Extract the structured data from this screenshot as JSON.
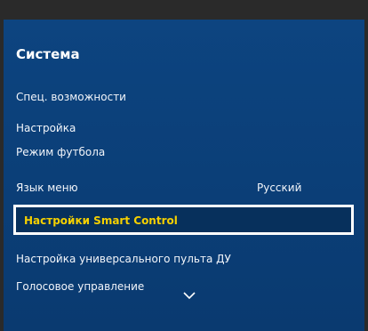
{
  "menu": {
    "title": "Система",
    "items": [
      {
        "label": "Спец. возможности"
      },
      {
        "label": "Настройка"
      },
      {
        "label": "Режим футбола"
      },
      {
        "label": "Язык меню",
        "value": "Русский"
      },
      {
        "label": "Настройки Smart Control"
      },
      {
        "label": "Настройка универсального пульта ДУ"
      },
      {
        "label": "Голосовое управление"
      }
    ],
    "selected_index": 4,
    "scroll_icon": "chevron-down-icon"
  },
  "colors": {
    "panel_bg": "#0b3f78",
    "selected_text": "#f5d000",
    "selected_border": "#ffffff",
    "text": "#f2f5fa"
  }
}
